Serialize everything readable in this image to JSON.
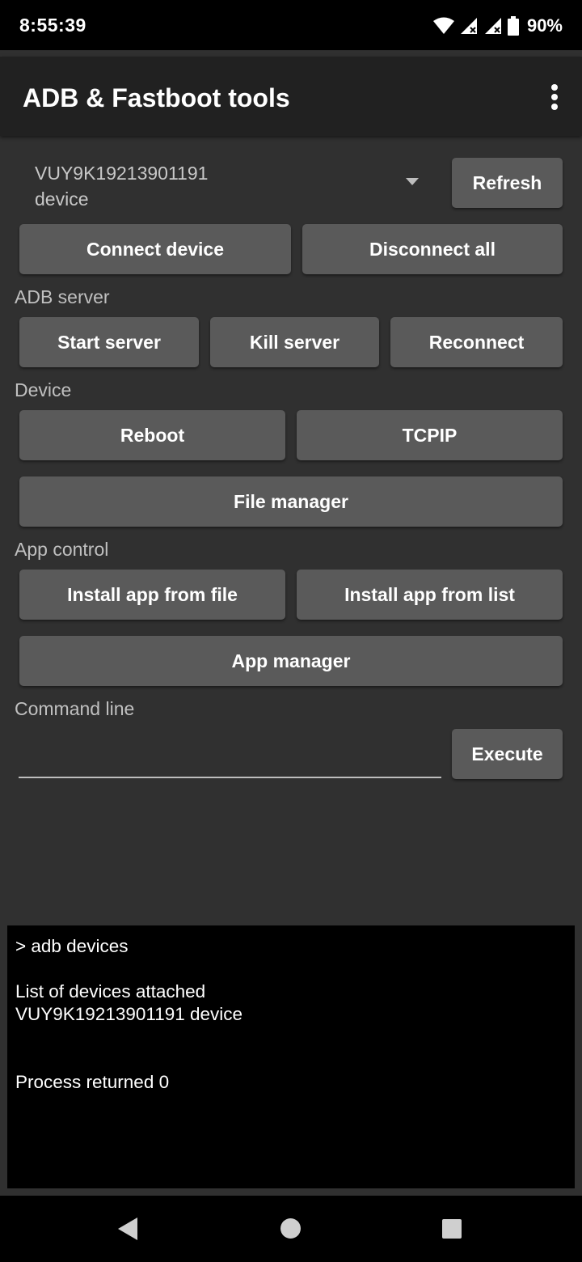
{
  "status_bar": {
    "time": "8:55:39",
    "battery": "90%",
    "icons": [
      "wifi-icon",
      "signal-icon",
      "signal-icon",
      "battery-icon"
    ]
  },
  "app_bar": {
    "title": "ADB & Fastboot tools",
    "overflow_icon": "more-vert-icon"
  },
  "device_selector": {
    "selected": "VUY9K19213901191\ndevice",
    "dropdown_icon": "dropdown-arrow-icon"
  },
  "buttons": {
    "refresh": "Refresh",
    "connect_device": "Connect device",
    "disconnect_all": "Disconnect all",
    "start_server": "Start server",
    "kill_server": "Kill server",
    "reconnect": "Reconnect",
    "reboot": "Reboot",
    "tcpip": "TCPIP",
    "file_manager": "File manager",
    "install_from_file": "Install app from file",
    "install_from_list": "Install app from list",
    "app_manager": "App manager",
    "execute": "Execute"
  },
  "sections": {
    "adb_server": "ADB server",
    "device": "Device",
    "app_control": "App control",
    "command_line": "Command line"
  },
  "command_input": {
    "value": "",
    "placeholder": ""
  },
  "console": {
    "lines": [
      "> adb devices",
      "",
      "List of devices attached",
      "VUY9K19213901191 device",
      "",
      "",
      "Process returned 0"
    ]
  },
  "nav_bar": {
    "icons": [
      "back-icon",
      "home-icon",
      "recents-icon"
    ]
  },
  "colors": {
    "background": "#303030",
    "app_bar": "#212121",
    "button": "#5a5a5a",
    "console_bg": "#000000",
    "text_secondary": "#c0c0c0"
  }
}
